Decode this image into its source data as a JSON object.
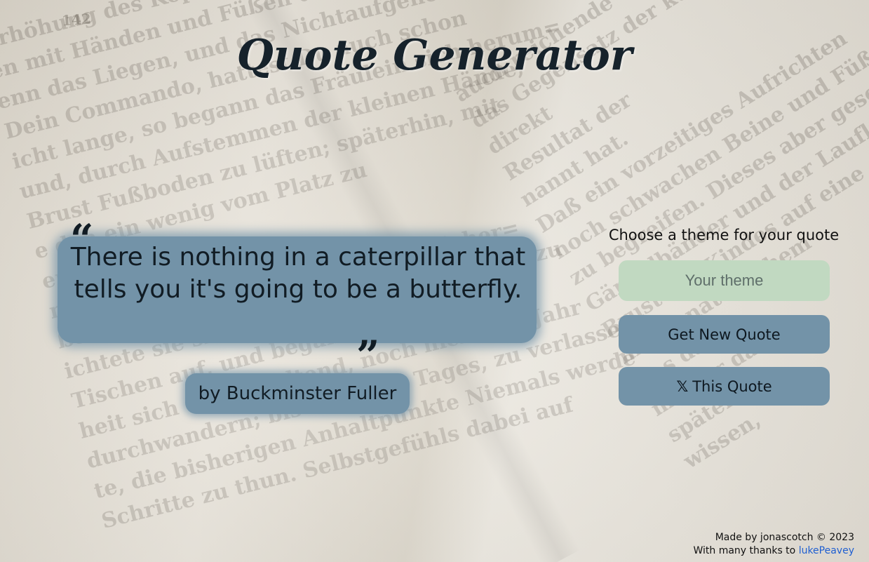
{
  "app": {
    "title": "Quote Generator"
  },
  "background": {
    "page_number": "142",
    "left_page_lines": [
      "Erhöhung des Kopfes.  Das gab",
      "en mit Händen und Füßen das",
      "enn das Liegen, und das Nichtaufgenommen=",
      "Dein Commando, hattest Du auch schon",
      "icht lange, so begann das Fräulein sich herum=",
      "und, durch Aufstemmen der kleinen Hände,",
      "Brust Fußboden zu lüften; späterhin, mit",
      "e den  ein wenig vom Platz zu",
      "en, mehr zu",
      "mehr zu unglaublicher",
      "ßen, mit  der Hand Umsicht und Sicher=",
      "ichtete sie sich,  durch das Zimmer rings zu",
      "Tischen auf, und begann,  das ganze",
      "heit sich daran haltend, noch nicht ein Jahr",
      "durchwandern; bis sie eines Tages, zu verlassen,",
      "te, die bisherigen Anhaltpunkte  Niemals werde",
      "Schritte zu thun.  Selbstgefühls dabei auf"
    ],
    "right_page_lines": [
      "auch reichende",
      "das Gegensatz der künstlich",
      "direkt",
      "Resultat der",
      "nannt hat.",
      "Daß ein vorzeitiges Aufrichten",
      "noch schwachen Beine und Füße ungewe",
      "zu begreifen.  Dieses aber geschieht",
      "Gängelbänder und der Laufkörbe",
      "Brust des Kindes auf eine",
      "mit unnatürlichem",
      "Das  da",
      "minder  daß",
      "späterhin",
      "wissen,"
    ]
  },
  "quote": {
    "open_mark": "“",
    "text": "There is nothing in a caterpillar that tells you it's going to be a butterfly.",
    "close_mark": "”",
    "author": "by Buckminster Fuller"
  },
  "controls": {
    "theme_label": "Choose a theme for your quote",
    "theme_input_placeholder": "Your theme",
    "theme_input_value": "",
    "new_quote_label": "Get New Quote",
    "x_icon_glyph": "𝕏",
    "x_quote_label": "This Quote"
  },
  "footer": {
    "made_by": "Made by jonascotch © 2023",
    "thanks_prefix": "With many thanks to ",
    "thanks_link": "lukePeavey"
  },
  "colors": {
    "quote_bg": "#7393a8",
    "input_bg": "#c1d9c1",
    "link": "#1f5fd1",
    "text_dark": "#111c24"
  },
  "icons": {
    "x_logo": "x-logo-icon"
  }
}
